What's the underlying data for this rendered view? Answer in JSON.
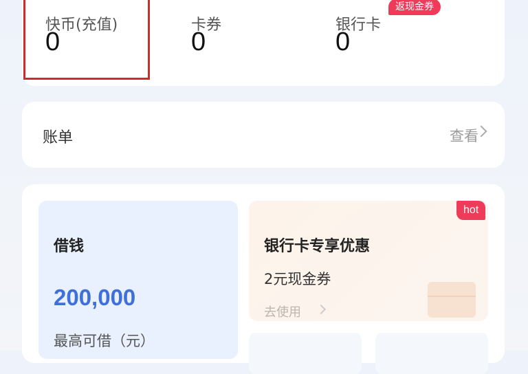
{
  "balances": {
    "coin": {
      "label": "快币(充值)",
      "value": "0"
    },
    "coupon": {
      "label": "卡券",
      "value": "0"
    },
    "bank": {
      "label": "银行卡",
      "value": "0",
      "badge": "返现金券"
    }
  },
  "bill": {
    "title": "账单",
    "action": "查看"
  },
  "loan": {
    "title": "借钱",
    "amount": "200,000",
    "note": "最高可借（元）"
  },
  "promo": {
    "title": "银行卡专享优惠",
    "subtitle": "2元现金券",
    "action": "去使用",
    "badge": "hot"
  },
  "colors": {
    "accent_blue": "#3f6fd8",
    "badge_red": "#ef3b5a",
    "highlight_red": "#d12a2a"
  }
}
